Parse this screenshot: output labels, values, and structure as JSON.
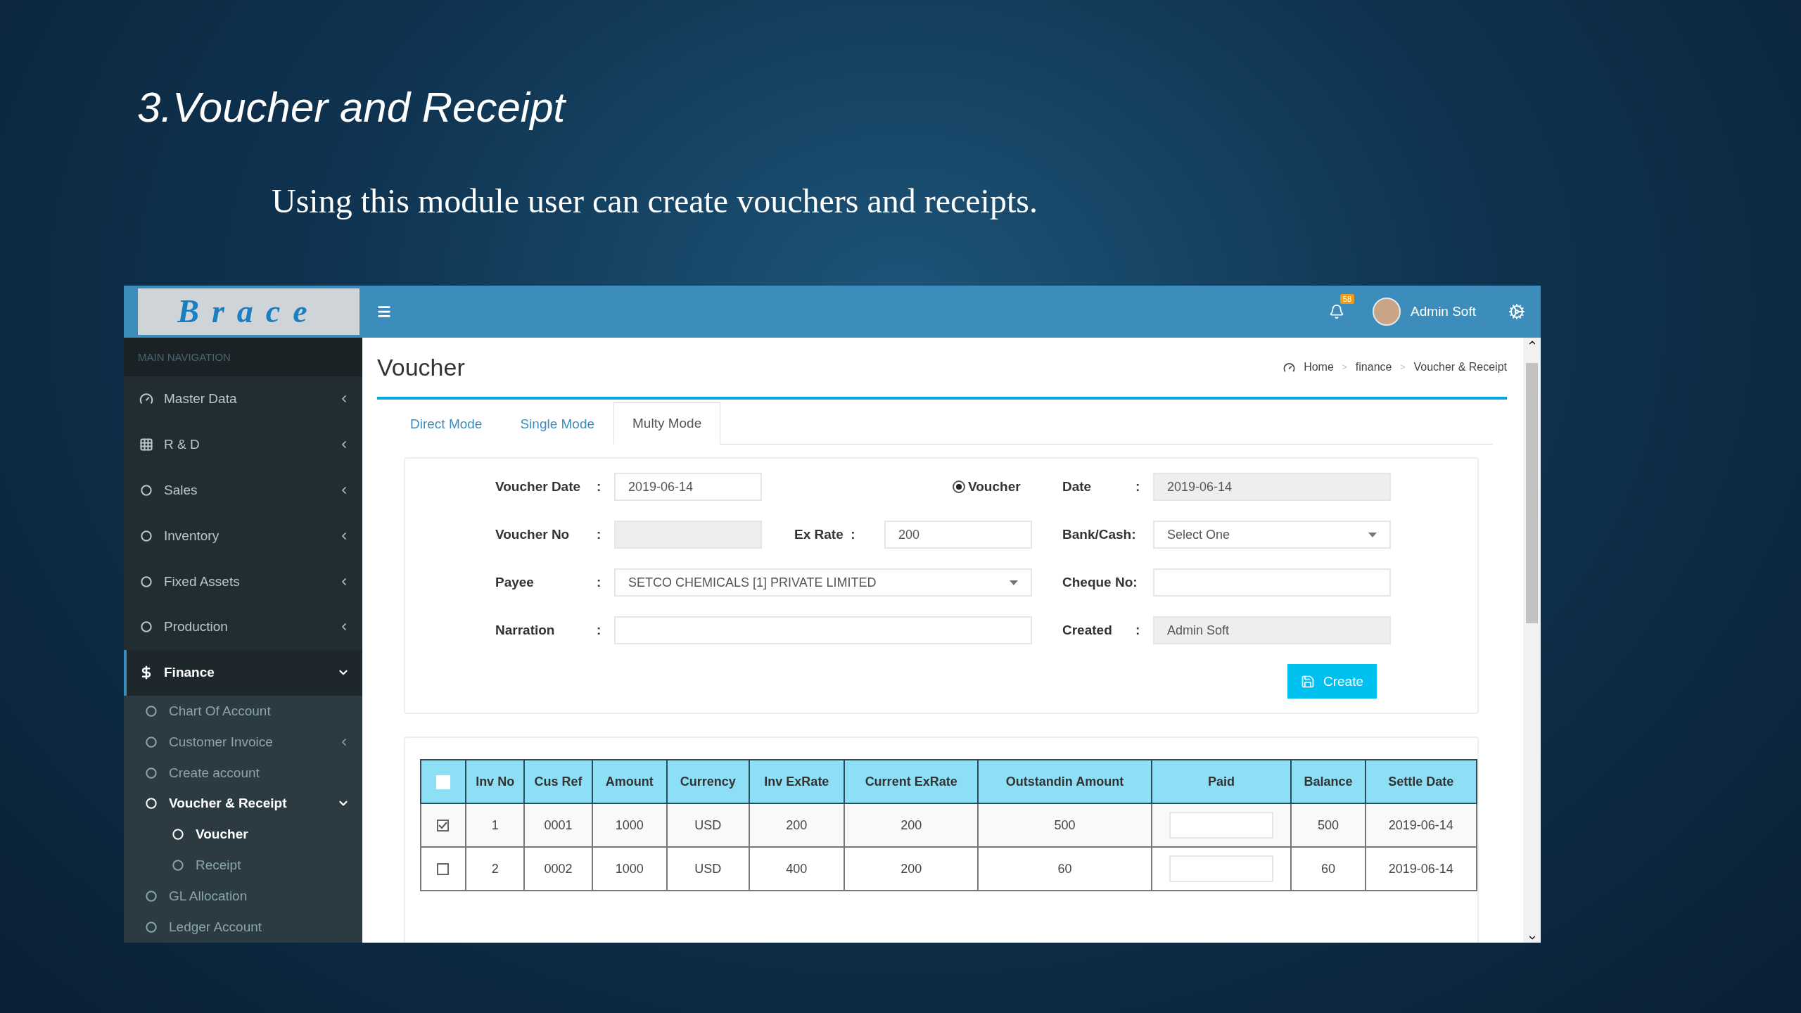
{
  "slide": {
    "title": "3.Voucher and Receipt",
    "subtitle": "Using this module user can create vouchers and receipts."
  },
  "app": {
    "logo": "Brace",
    "header": {
      "notification_count": "58",
      "user": "Admin Soft"
    },
    "sidebar": {
      "heading": "MAIN NAVIGATION",
      "items": [
        {
          "label": "Master Data",
          "submenu": true,
          "expanded": false,
          "selected": false
        },
        {
          "label": "R & D",
          "submenu": true,
          "expanded": false,
          "selected": false
        },
        {
          "label": "Sales",
          "submenu": true,
          "expanded": false,
          "selected": false
        },
        {
          "label": "Inventory",
          "submenu": true,
          "expanded": false,
          "selected": false
        },
        {
          "label": "Fixed Assets",
          "submenu": true,
          "expanded": false,
          "selected": false
        },
        {
          "label": "Production",
          "submenu": true,
          "expanded": false,
          "selected": false
        },
        {
          "label": "Finance",
          "submenu": true,
          "expanded": true,
          "selected": true,
          "children": [
            {
              "label": "Chart Of Account",
              "submenu": false,
              "selected": false
            },
            {
              "label": "Customer Invoice",
              "submenu": true,
              "expanded": false,
              "selected": false
            },
            {
              "label": "Create account",
              "submenu": false,
              "selected": false
            },
            {
              "label": "Voucher & Receipt",
              "submenu": true,
              "expanded": true,
              "selected": true,
              "children": [
                {
                  "label": "Voucher",
                  "submenu": false,
                  "selected": true
                },
                {
                  "label": "Receipt",
                  "submenu": false,
                  "selected": false
                }
              ]
            },
            {
              "label": "GL Allocation",
              "submenu": false,
              "selected": false
            },
            {
              "label": "Ledger Account",
              "submenu": false,
              "selected": false
            }
          ]
        }
      ]
    },
    "page": {
      "title": "Voucher",
      "breadcrumb": [
        {
          "label": "Home"
        },
        {
          "separator": ">",
          "label": "finance"
        },
        {
          "separator": ">",
          "label": "Voucher & Receipt"
        }
      ],
      "tabs": [
        {
          "label": "Direct Mode",
          "selected": false
        },
        {
          "label": "Single Mode",
          "selected": false
        },
        {
          "label": "Multy Mode",
          "selected": true
        }
      ],
      "form": {
        "voucher_date": {
          "label": "Voucher Date",
          "colon": ":",
          "value": "2019-06-14",
          "disabled": false
        },
        "voucher_no": {
          "label": "Voucher No",
          "colon": ":",
          "disabled": true
        },
        "ex_rate": {
          "label": "Ex Rate",
          "colon": ":",
          "value": "200",
          "disabled": false
        },
        "payee": {
          "label": "Payee",
          "colon": ":",
          "value": "SETCO CHEMICALS [1] PRIVATE LIMITED",
          "disabled": false
        },
        "narration": {
          "label": "Narration",
          "colon": ":",
          "disabled": false
        },
        "type_radio": {
          "label": "Voucher",
          "selected": true
        },
        "date": {
          "label": "Date",
          "colon": ":",
          "value": "2019-06-14",
          "disabled": true
        },
        "bank_cash": {
          "label": "Bank/Cash:",
          "value": "Select One",
          "disabled": false
        },
        "cheque_no": {
          "label": "Cheque No:",
          "disabled": false
        },
        "created": {
          "label": "Created",
          "colon": ":",
          "value": "Admin Soft",
          "disabled": true
        },
        "create_button": "Create"
      },
      "table": {
        "header_checked": false,
        "columns": [
          {
            "label": "Inv No",
            "kind": "text"
          },
          {
            "label": "Cus Ref",
            "kind": "text"
          },
          {
            "label": "Amount",
            "kind": "text"
          },
          {
            "label": "Currency",
            "kind": "text"
          },
          {
            "label": "Inv ExRate",
            "kind": "text"
          },
          {
            "label": "Current ExRate",
            "kind": "text"
          },
          {
            "label": "Outstandin Amount",
            "kind": "text"
          },
          {
            "label": "Paid",
            "kind": "input"
          },
          {
            "label": "Balance",
            "kind": "text"
          },
          {
            "label": "Settle Date",
            "kind": "text"
          }
        ],
        "rows": [
          {
            "checked": true,
            "values": [
              "1",
              "0001",
              "1000",
              "USD",
              "200",
              "200",
              "500",
              "500",
              "2019-06-14"
            ]
          },
          {
            "checked": false,
            "values": [
              "2",
              "0002",
              "1000",
              "USD",
              "400",
              "200",
              "60",
              "60",
              "2019-06-14"
            ]
          }
        ]
      }
    }
  }
}
